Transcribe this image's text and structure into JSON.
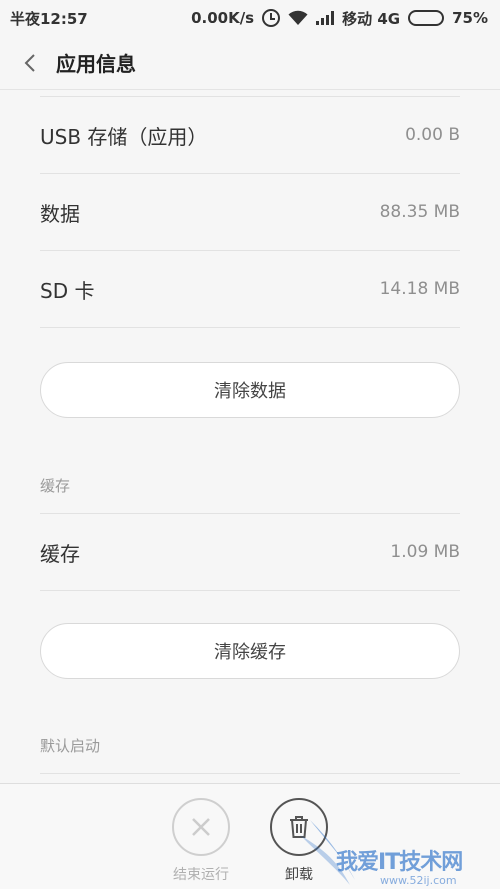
{
  "status_bar": {
    "time": "半夜12:57",
    "speed": "0.00K/s",
    "carrier": "移动 4G",
    "battery_percent": "75%",
    "battery_level": 0.75
  },
  "header": {
    "title": "应用信息"
  },
  "storage_rows": [
    {
      "label": "USB 存储（应用）",
      "value": "0.00 B"
    },
    {
      "label": "数据",
      "value": "88.35 MB"
    },
    {
      "label": "SD 卡",
      "value": "14.18 MB"
    }
  ],
  "clear_data_button": "清除数据",
  "cache_section": {
    "header": "缓存",
    "row_label": "缓存",
    "row_value": "1.09 MB",
    "clear_button": "清除缓存"
  },
  "default_launch_section": {
    "header": "默认启动"
  },
  "bottom_actions": {
    "force_stop": "结束运行",
    "uninstall": "卸载"
  },
  "watermark": {
    "text": "我爱IT技术网",
    "sub": "www.52ij.com"
  },
  "colors": {
    "background": "#f6f6f6",
    "text_primary": "#333333",
    "text_secondary": "#8f8f8f",
    "watermark": "#286ec8"
  }
}
